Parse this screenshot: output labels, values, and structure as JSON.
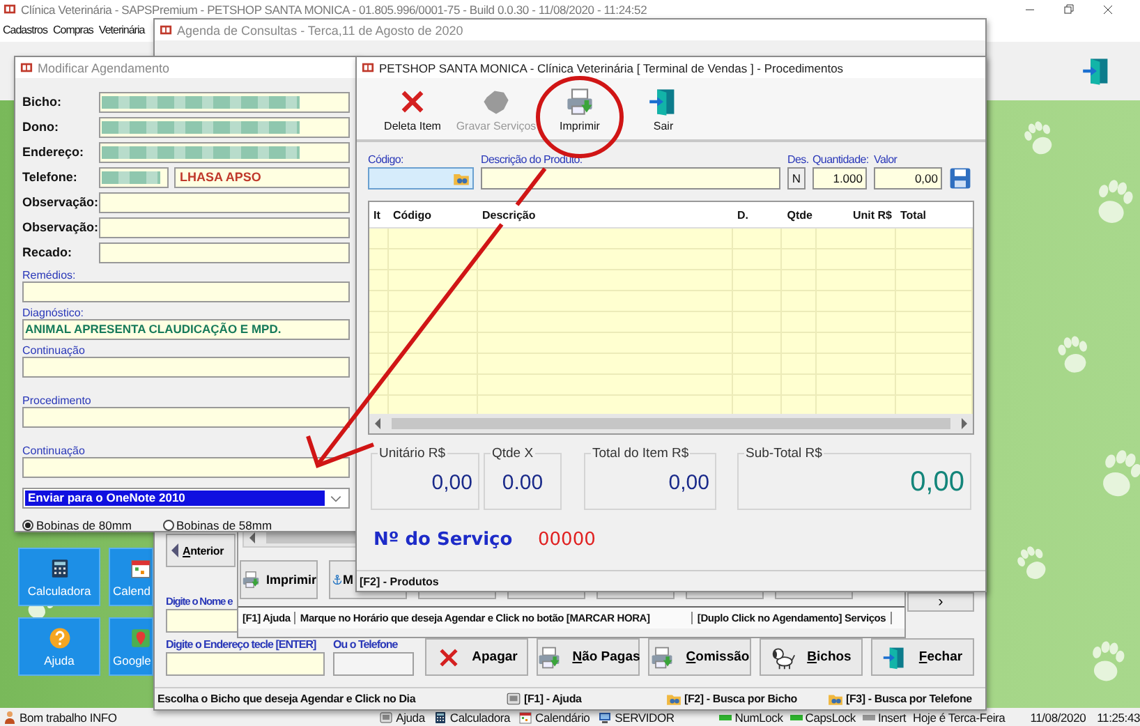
{
  "main_window": {
    "title": "Clínica Veterinária - SAPSPremium - PETSHOP SANTA MONICA - 01.805.996/0001-75 - Build 0.0.30 - 11/08/2020 - 11:24:52",
    "menu": [
      {
        "label": "Cadastros"
      },
      {
        "label": "Compras"
      },
      {
        "label": "Veterinária"
      }
    ],
    "tiles": [
      {
        "label": "Calculadora"
      },
      {
        "label": "Calend"
      },
      {
        "label": "Ajuda"
      },
      {
        "label": "Google"
      }
    ],
    "status_bar": {
      "greeting": "Bom trabalho INFO",
      "shortcuts": [
        {
          "label": "Ajuda"
        },
        {
          "label": "Calculadora"
        },
        {
          "label": "Calendário"
        },
        {
          "label": "SERVIDOR"
        }
      ],
      "indicators": [
        {
          "label": "NumLock",
          "on": true
        },
        {
          "label": "CapsLock",
          "on": true
        },
        {
          "label": "Insert",
          "on": false
        }
      ],
      "day": "Hoje é Terca-Feira",
      "date": "11/08/2020",
      "time": "11:25:43"
    }
  },
  "agenda_window": {
    "title": "Agenda de Consultas - Terca,11 de Agosto de 2020",
    "previous_button": {
      "label": "Anterior",
      "mnemonic": true
    },
    "next_button": "›",
    "name_label": "Digite o Nome e",
    "address_label": "Digite o Endereço tecle [ENTER]",
    "phone_label": "Ou o Telefone",
    "actions": [
      {
        "label": "Apagar",
        "mnemonic": false
      },
      {
        "label": "Não Pagas",
        "mnemonic": true
      },
      {
        "label": "Comissão",
        "mnemonic": true
      },
      {
        "label": "Bichos",
        "mnemonic": true
      },
      {
        "label": "Fechar",
        "mnemonic": true
      }
    ],
    "status_bar": [
      "Escolha o Bicho que deseja Agendar e Click no Dia",
      "[F1] - Ajuda",
      "[F2] - Busca por Bicho",
      "[F3] - Busca por Telefone"
    ],
    "schedule_panel": {
      "buttons": [
        "Imprimir",
        "M"
      ],
      "status_bar": [
        "[F1] Ajuda",
        "Marque no Horário que deseja Agendar e Click no botão [MARCAR HORA]",
        "[Duplo Click no Agendamento] Serviços"
      ]
    }
  },
  "modify_window": {
    "title": "Modificar Agendamento",
    "rows": [
      {
        "label": "Bicho:",
        "redacted": true
      },
      {
        "label": "Dono:",
        "redacted": true
      },
      {
        "label": "Endereço:",
        "redacted": true
      },
      {
        "label": "Telefone:",
        "redacted": true,
        "breed": "LHASA APSO"
      },
      {
        "label": "Observação:",
        "redacted": false
      },
      {
        "label": "Observação:",
        "redacted": false
      },
      {
        "label": "Recado:",
        "redacted": false
      }
    ],
    "text_fields": [
      {
        "label": "Remédios:"
      },
      {
        "label": "Diagnóstico:",
        "value": "ANIMAL APRESENTA CLAUDICAÇÃO E MPD."
      },
      {
        "label": "Continuação"
      },
      {
        "label": "Procedimento"
      },
      {
        "label": "Continuação"
      }
    ],
    "printer": {
      "value": "Enviar para o OneNote 2010"
    },
    "paper": [
      {
        "label": "Bobinas de 80mm",
        "selected": true
      },
      {
        "label": "Bobinas de 58mm",
        "selected": false
      }
    ]
  },
  "procedures_window": {
    "title": "PETSHOP SANTA MONICA - Clínica Veterinária [ Terminal de Vendas ] - Procedimentos",
    "toolbar": [
      {
        "label": "Deleta Item",
        "disabled": false
      },
      {
        "label": "Gravar Serviços",
        "disabled": true
      },
      {
        "label": "Imprimir",
        "disabled": false
      },
      {
        "label": "Sair",
        "disabled": false
      }
    ],
    "fields": {
      "code": {
        "label": "Código:"
      },
      "description": {
        "label": "Descrição do Produto:"
      },
      "discount": {
        "label": "Des.",
        "value": "N"
      },
      "quantity": {
        "label": "Quantidade:",
        "value": "1.000"
      },
      "price": {
        "label": "Valor",
        "value": "0,00"
      }
    },
    "table": {
      "columns": [
        "It",
        "Código",
        "Descrição",
        "D.",
        "Qtde",
        "Unit R$",
        "Total"
      ]
    },
    "totals": [
      {
        "label": "Unitário R$",
        "value": "0,00"
      },
      {
        "label": "Qtde X",
        "value": "0.00"
      },
      {
        "label": "Total do Item R$",
        "value": "0,00"
      },
      {
        "label": "Sub-Total R$",
        "value": "0,00"
      }
    ],
    "service": {
      "label": "Nº do Serviço",
      "number": "00000"
    },
    "status_bar": "[F2] - Produtos"
  }
}
